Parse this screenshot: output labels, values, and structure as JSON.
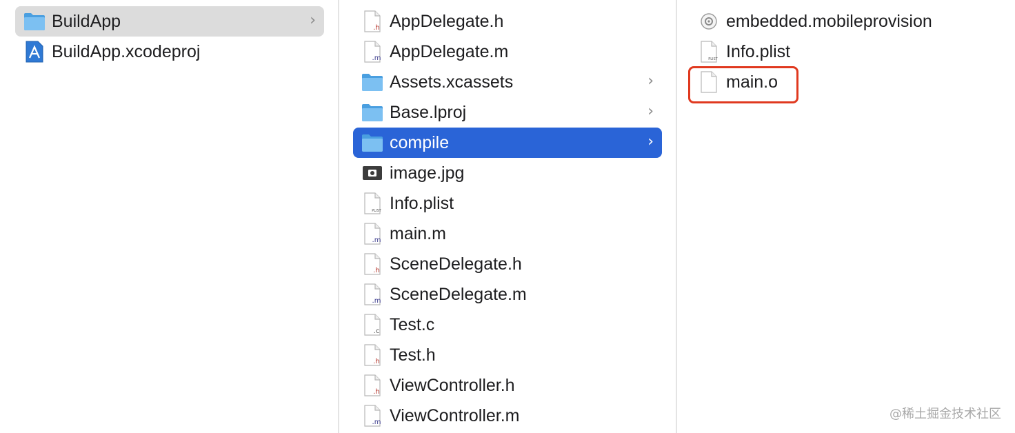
{
  "columns": [
    {
      "items": [
        {
          "name": "BuildApp",
          "icon": "folder-icon",
          "chevron": true,
          "selected": "gray"
        },
        {
          "name": "BuildApp.xcodeproj",
          "icon": "xcodeproj-icon",
          "chevron": false,
          "selected": ""
        }
      ]
    },
    {
      "items": [
        {
          "name": "AppDelegate.h",
          "icon": "h-file-icon",
          "chevron": false,
          "selected": ""
        },
        {
          "name": "AppDelegate.m",
          "icon": "m-file-icon",
          "chevron": false,
          "selected": ""
        },
        {
          "name": "Assets.xcassets",
          "icon": "folder-icon",
          "chevron": true,
          "selected": ""
        },
        {
          "name": "Base.lproj",
          "icon": "folder-icon",
          "chevron": true,
          "selected": ""
        },
        {
          "name": "compile",
          "icon": "folder-icon",
          "chevron": true,
          "selected": "blue"
        },
        {
          "name": "image.jpg",
          "icon": "image-file-icon",
          "chevron": false,
          "selected": ""
        },
        {
          "name": "Info.plist",
          "icon": "plist-file-icon",
          "chevron": false,
          "selected": ""
        },
        {
          "name": "main.m",
          "icon": "m-file-icon",
          "chevron": false,
          "selected": ""
        },
        {
          "name": "SceneDelegate.h",
          "icon": "h-file-icon",
          "chevron": false,
          "selected": ""
        },
        {
          "name": "SceneDelegate.m",
          "icon": "m-file-icon",
          "chevron": false,
          "selected": ""
        },
        {
          "name": "Test.c",
          "icon": "c-file-icon",
          "chevron": false,
          "selected": ""
        },
        {
          "name": "Test.h",
          "icon": "h-file-icon",
          "chevron": false,
          "selected": ""
        },
        {
          "name": "ViewController.h",
          "icon": "h-file-icon",
          "chevron": false,
          "selected": ""
        },
        {
          "name": "ViewController.m",
          "icon": "m-file-icon",
          "chevron": false,
          "selected": ""
        }
      ]
    },
    {
      "items": [
        {
          "name": "embedded.mobileprovision",
          "icon": "provision-file-icon",
          "chevron": false,
          "selected": ""
        },
        {
          "name": "Info.plist",
          "icon": "plist-file-icon",
          "chevron": false,
          "selected": ""
        },
        {
          "name": "main.o",
          "icon": "blank-file-icon",
          "chevron": false,
          "selected": ""
        }
      ]
    }
  ],
  "icons": {
    "h_letter": ".h",
    "m_letter": ".m",
    "c_letter": ".c",
    "plist_letter": "PLIST"
  },
  "colors": {
    "selection_blue": "#2a64d7",
    "selection_gray": "#dcdcdc",
    "highlight_red": "#e0391f",
    "folder_blue": "#5aaee8"
  },
  "watermark": "@稀土掘金技术社区"
}
